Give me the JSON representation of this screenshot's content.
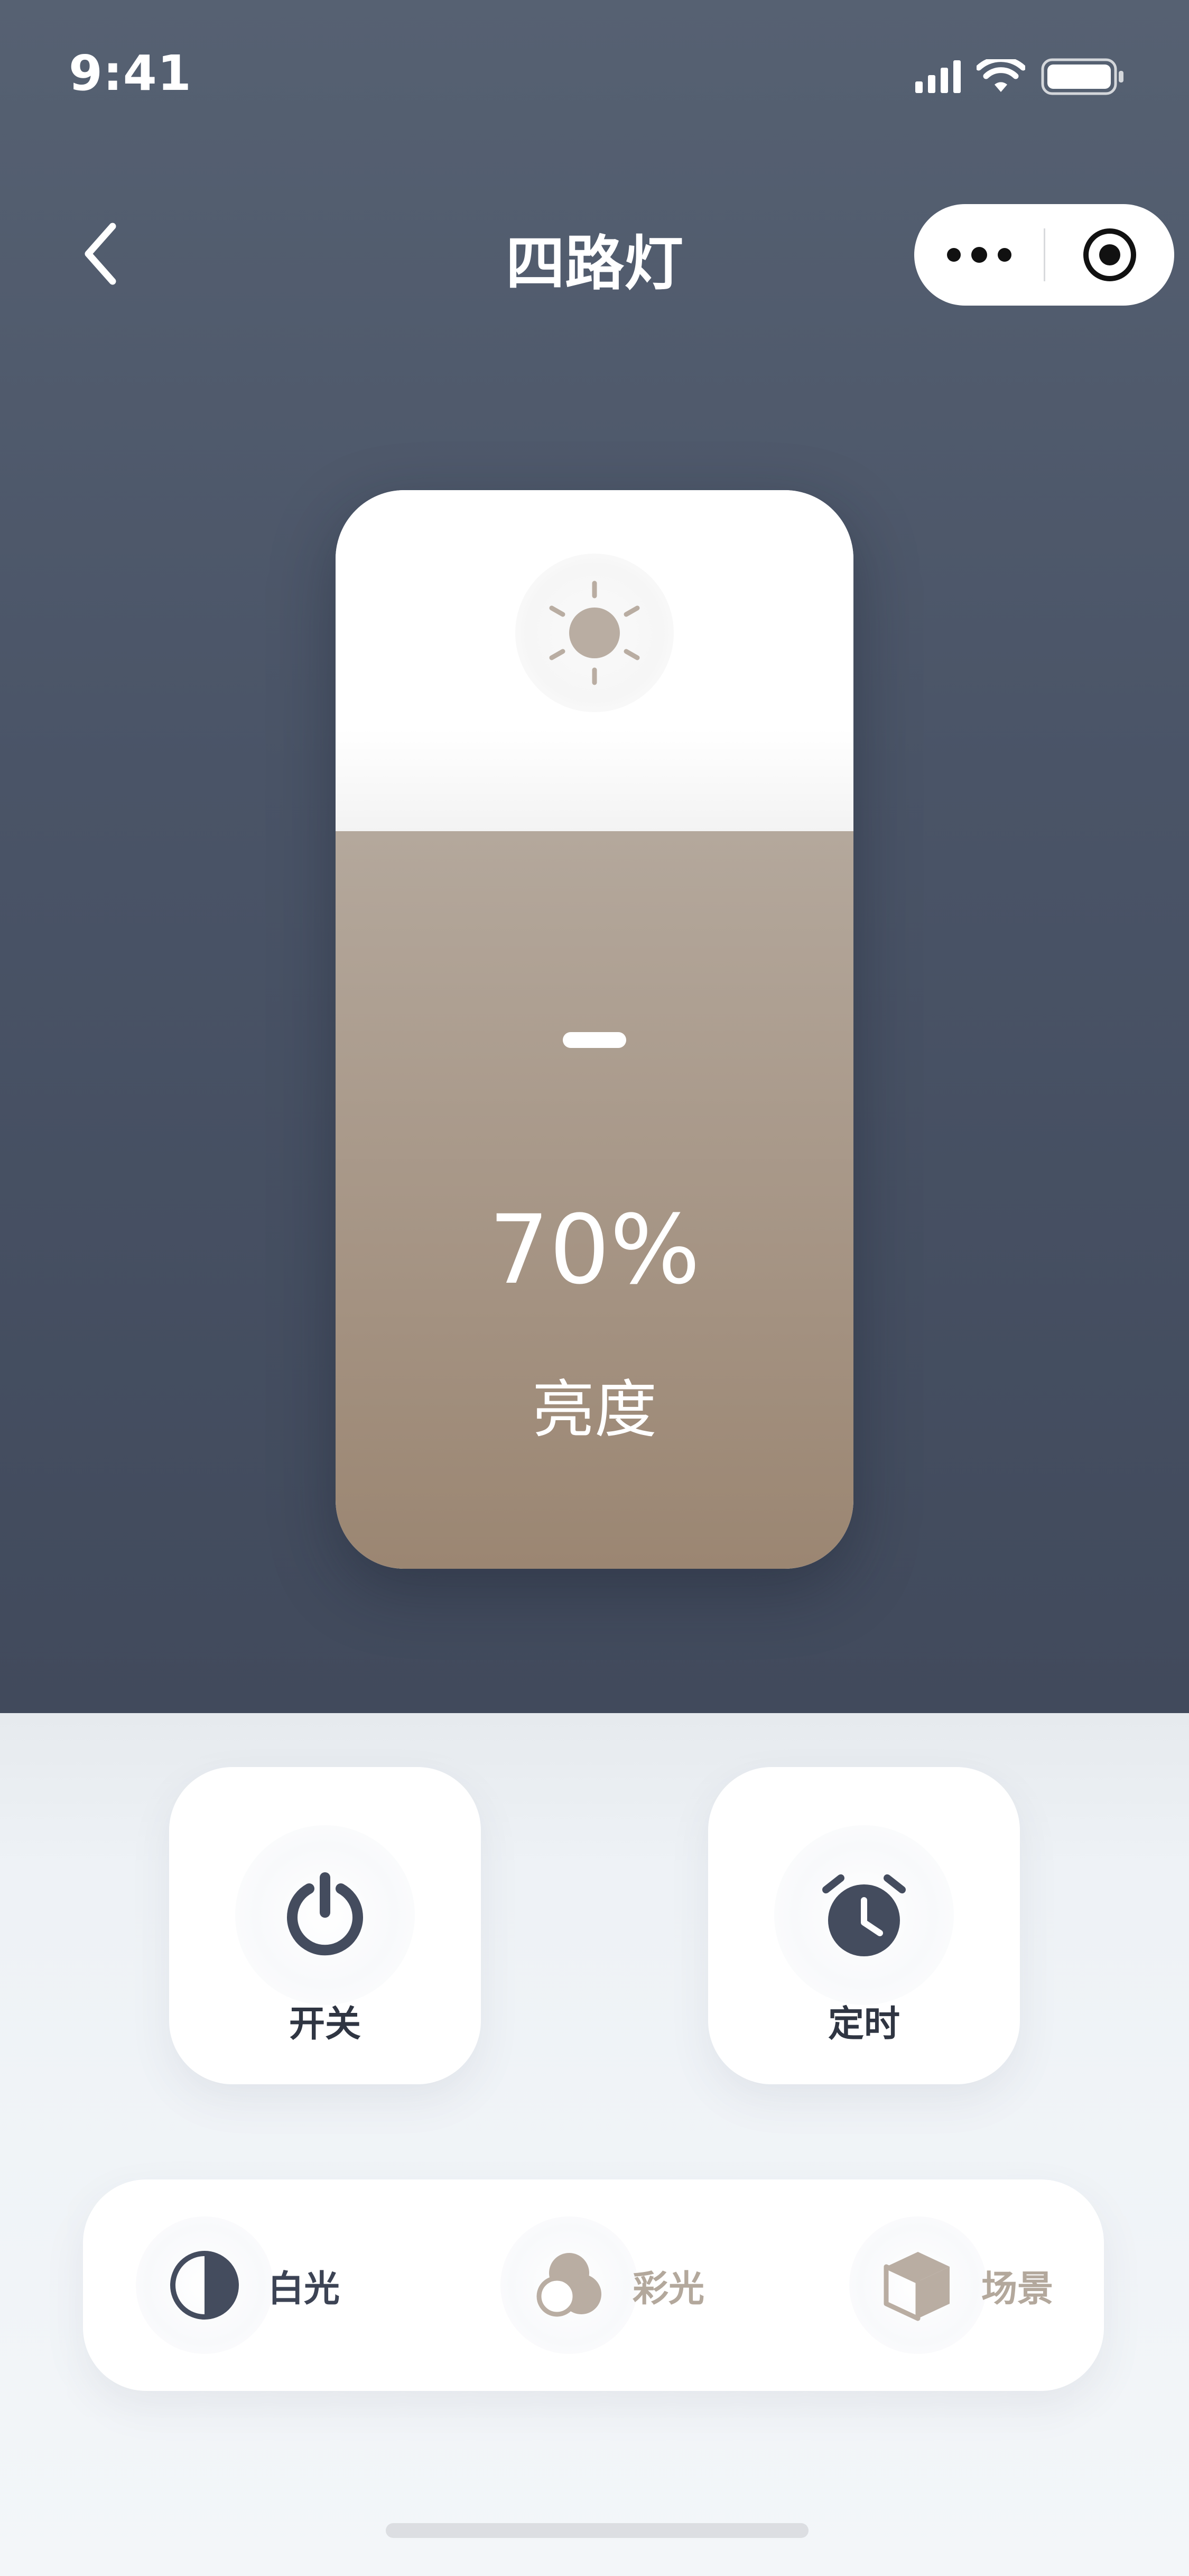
{
  "status_bar": {
    "time": "9:41",
    "icons": [
      "signal-icon",
      "wifi-icon",
      "battery-icon"
    ]
  },
  "nav": {
    "back_icon": "chevron-left-icon",
    "title": "四路灯",
    "capsule_icons": [
      "more-dots-icon",
      "close-target-icon"
    ]
  },
  "brightness": {
    "icon": "sun-icon",
    "level": 0.7,
    "value_text": "70%",
    "label": "亮度"
  },
  "actions": {
    "power": {
      "label": "开关",
      "icon": "power-icon"
    },
    "timer": {
      "label": "定时",
      "icon": "alarm-clock-icon"
    }
  },
  "modes": {
    "white": {
      "label": "白光",
      "icon": "half-circle-icon",
      "active": true
    },
    "color": {
      "label": "彩光",
      "icon": "color-circles-icon",
      "active": false
    },
    "scene": {
      "label": "场景",
      "icon": "cube-icon",
      "active": false
    }
  },
  "colors": {
    "header_bg": "#4a5467",
    "accent_brown": "#a69585",
    "active_text": "#3c4354",
    "inactive_text": "#b3a89c"
  }
}
